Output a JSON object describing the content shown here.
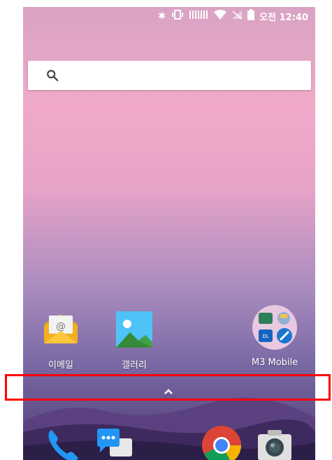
{
  "status_bar": {
    "time": "오전 12:40",
    "icons": [
      "bluetooth-icon",
      "vibrate-icon",
      "signal-icon",
      "wifi-icon",
      "no-sim-icon",
      "battery-icon"
    ]
  },
  "search": {
    "icon": "search-icon"
  },
  "apps": [
    {
      "label": "이메일",
      "icon": "email-icon"
    },
    {
      "label": "갤러리",
      "icon": "gallery-icon"
    },
    {
      "label": "M3 Mobile",
      "icon": "m3-mobile-folder-icon"
    }
  ],
  "drawer": {
    "icon": "chevron-up-icon"
  },
  "dock": [
    "phone-icon",
    "messages-icon",
    "chrome-icon",
    "camera-icon"
  ],
  "colors": {
    "highlight": "#ff0000",
    "statusText": "#ffffff"
  }
}
